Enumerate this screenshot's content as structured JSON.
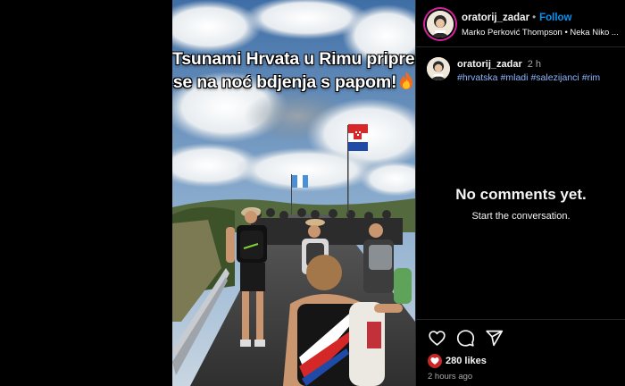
{
  "post": {
    "caption_overlay": [
      "Tsunami Hrvata u Rimu priprema",
      "se na noć bdjenja s papom!"
    ],
    "caption_emoji": "fire-emoji"
  },
  "header": {
    "username": "oratorij_zadar",
    "separator": "•",
    "follow_label": "Follow",
    "audio": "Marko Perković Thompson • Neka Niko ..."
  },
  "caption": {
    "username": "oratorij_zadar",
    "time": "2 h",
    "hashtags": [
      "#hrvatska",
      "#mladi",
      "#salezijanci",
      "#rim"
    ]
  },
  "comments": {
    "empty_title": "No comments yet.",
    "empty_subtitle": "Start the conversation."
  },
  "actions": {
    "icons": [
      "heart-icon",
      "comment-icon",
      "share-icon"
    ],
    "likes": "280 likes",
    "posted": "2 hours ago"
  },
  "colors": {
    "background": "#000000",
    "follow": "#0095f6",
    "hashtag": "#8fb6ff",
    "like_badge": "#c62828",
    "divider": "#262626"
  }
}
